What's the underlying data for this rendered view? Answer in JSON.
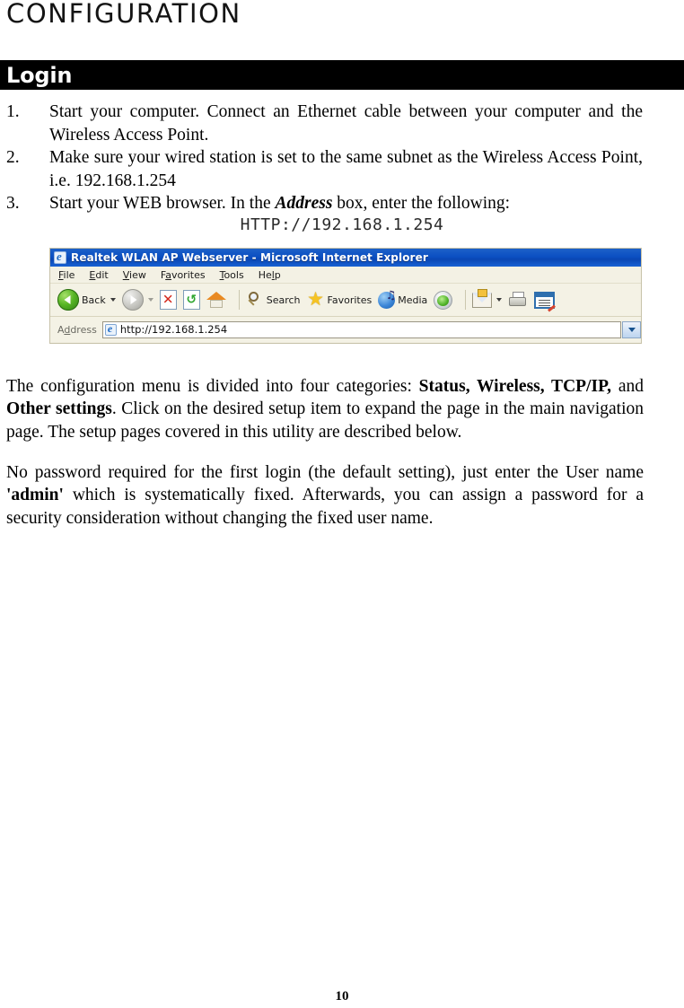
{
  "document": {
    "title": "CONFIGURATION",
    "page_number": "10"
  },
  "section": {
    "heading": "Login"
  },
  "steps": [
    {
      "number": "1.",
      "text": "Start your computer. Connect an Ethernet cable between your computer and the Wireless Access Point."
    },
    {
      "number": "2.",
      "text": "Make sure your wired station is set to the same subnet as the Wireless Access Point, i.e. 192.168.1.254"
    },
    {
      "number": "3.",
      "text_before": "Start your WEB browser. In the ",
      "emphasis": "Address",
      "text_after": " box, enter the following:"
    }
  ],
  "url_line": "HTTP://192.168.1.254",
  "browser": {
    "title": "Realtek WLAN AP Webserver - Microsoft Internet Explorer",
    "title_icon": "ie-logo-icon",
    "menu_items": [
      "File",
      "Edit",
      "View",
      "Favorites",
      "Tools",
      "Help"
    ],
    "toolbar": {
      "back_label": "Back",
      "back_icon": "back-arrow-icon",
      "forward_icon": "forward-arrow-icon",
      "stop_icon": "stop-icon",
      "refresh_icon": "refresh-icon",
      "home_icon": "home-icon",
      "search_label": "Search",
      "search_icon": "magnifier-icon",
      "favorites_label": "Favorites",
      "favorites_icon": "star-icon",
      "media_label": "Media",
      "media_icon": "media-globe-icon",
      "messenger_icon": "messenger-globe-icon",
      "mail_icon": "mail-envelope-icon",
      "print_icon": "printer-icon",
      "edit_icon": "edit-page-icon"
    },
    "address": {
      "label": "Address",
      "value": "http://192.168.1.254",
      "favicon": "ie-page-icon",
      "dropdown_icon": "chevron-down-icon"
    },
    "colors": {
      "titlebar": "#0b4fc2",
      "chrome": "#f4f2e5",
      "title_text": "#ffffff"
    }
  },
  "paragraphs": {
    "p1": {
      "part1": "The configuration menu is divided into four categories: ",
      "bold1": "Status, Wireless, TCP/IP,",
      "part2": " and ",
      "bold2": "Other settings",
      "part3": ".  Click on the desired setup item to expand the page in the main navigation page. The setup pages covered in this utility are described below."
    },
    "p2": {
      "part1": "No password required for the first login (the default setting), just enter the User name ",
      "bold1": "'admin'",
      "part2": " which is systematically fixed. Afterwards, you can assign a password for a security consideration without changing the fixed user name."
    }
  }
}
